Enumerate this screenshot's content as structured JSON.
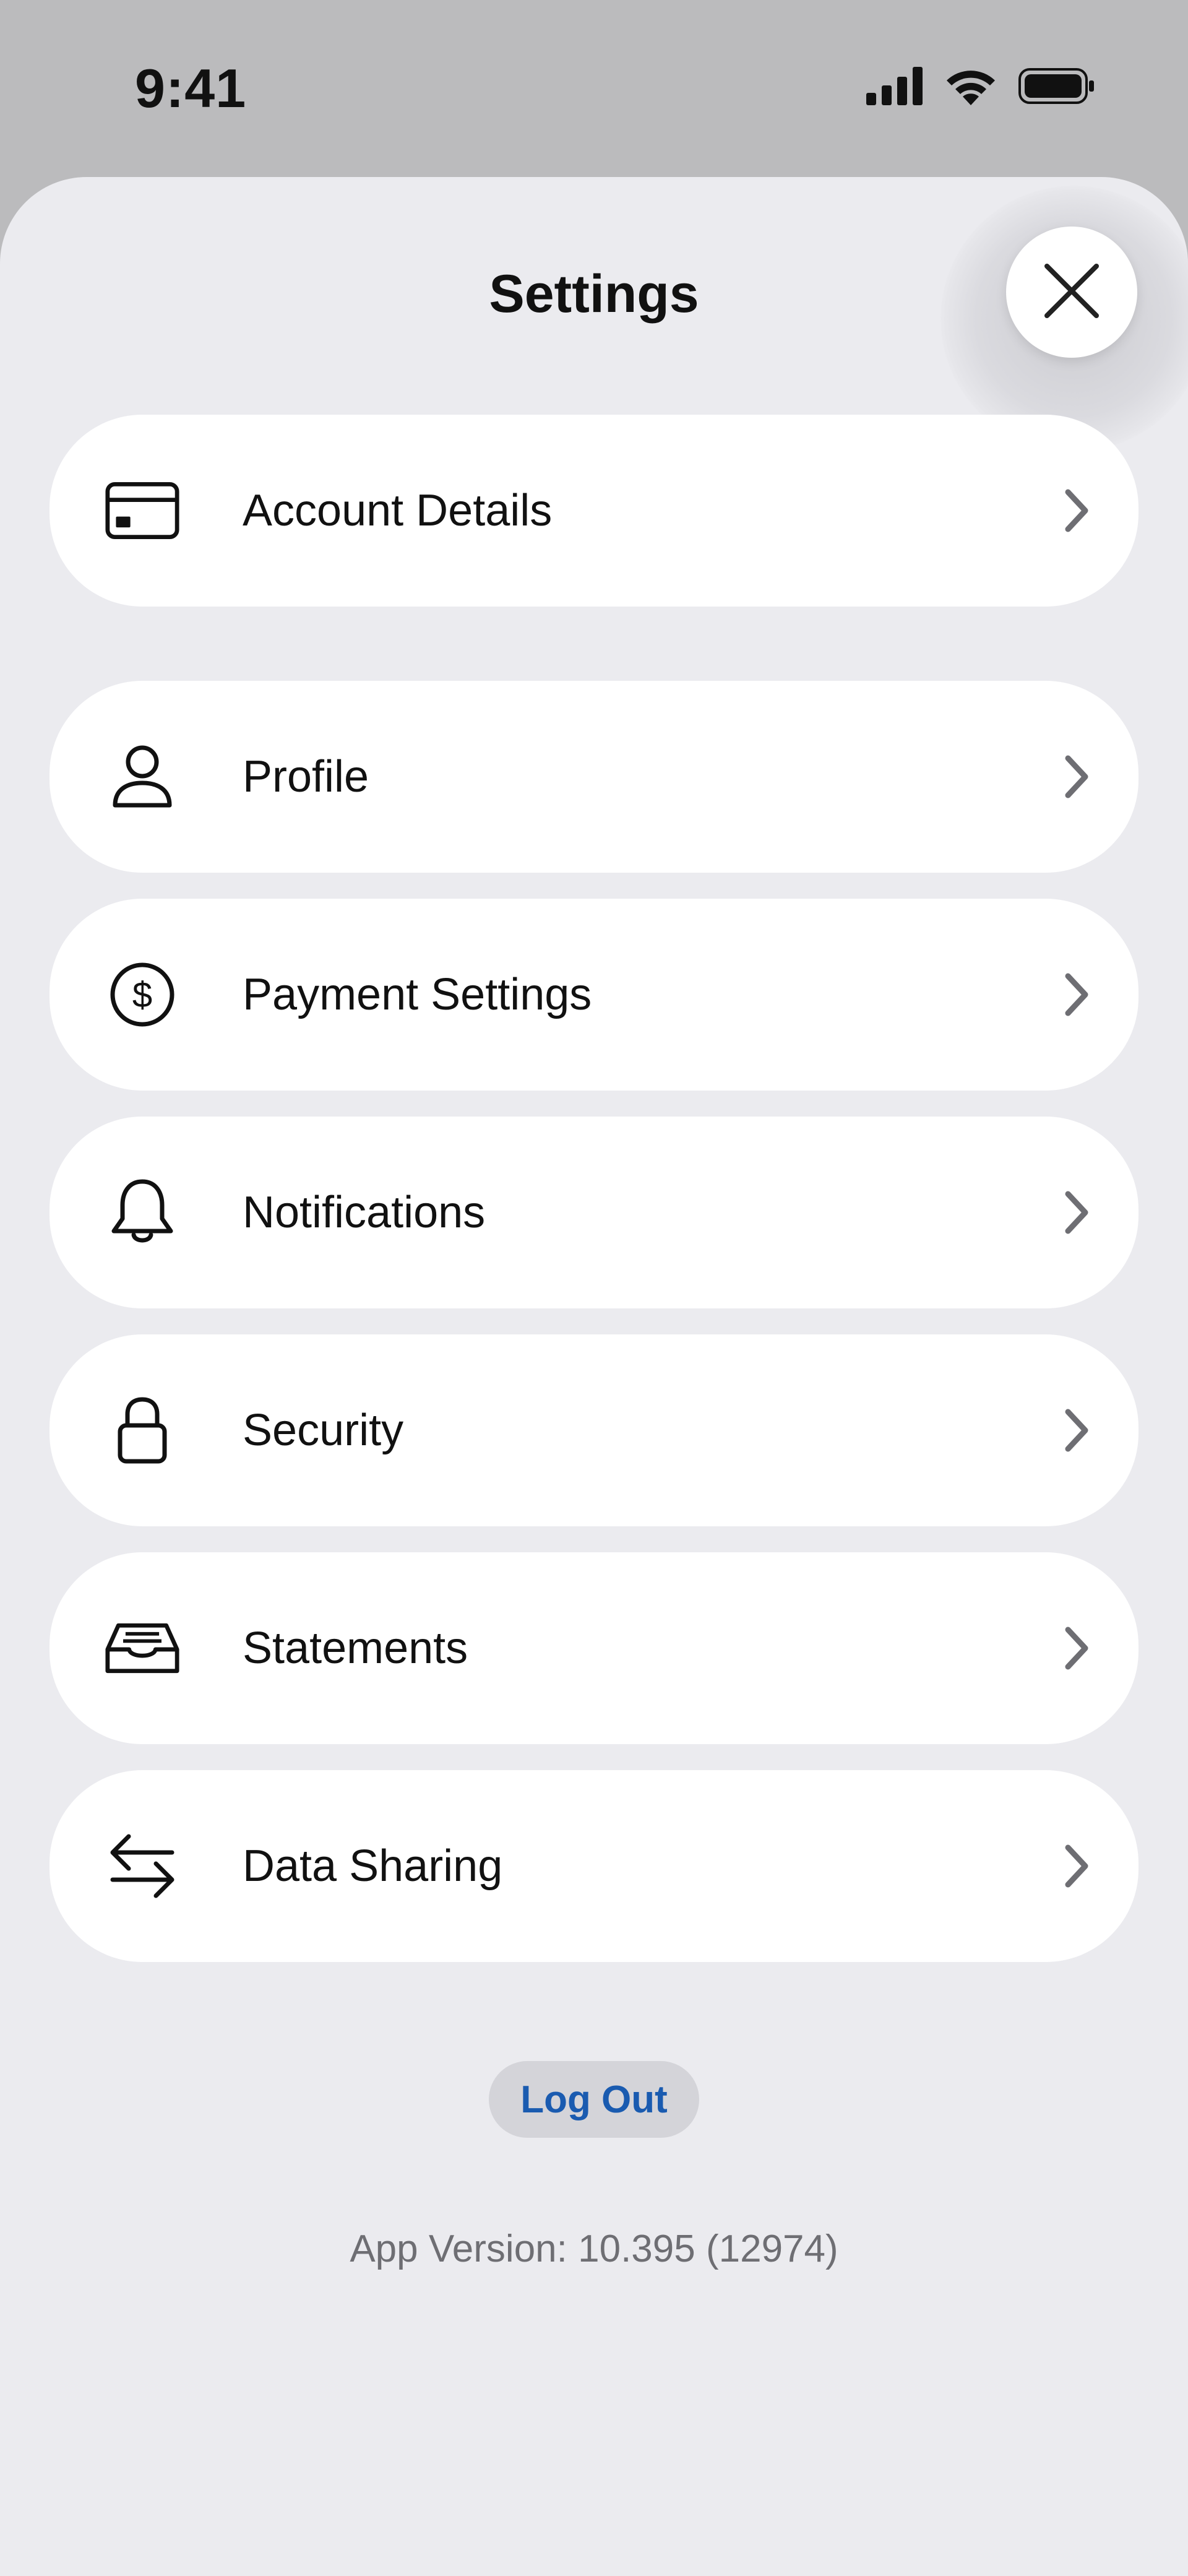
{
  "status_bar": {
    "time": "9:41",
    "icons": [
      "signal-icon",
      "wifi-icon",
      "battery-icon"
    ]
  },
  "header": {
    "title": "Settings",
    "close_icon": "close-icon"
  },
  "menu": {
    "items": [
      {
        "label": "Account Details",
        "icon": "card-icon"
      },
      {
        "label": "Profile",
        "icon": "person-icon"
      },
      {
        "label": "Payment Settings",
        "icon": "dollar-circle-icon"
      },
      {
        "label": "Notifications",
        "icon": "bell-icon"
      },
      {
        "label": "Security",
        "icon": "lock-icon"
      },
      {
        "label": "Statements",
        "icon": "inbox-tray-icon"
      },
      {
        "label": "Data Sharing",
        "icon": "arrows-swap-icon"
      }
    ]
  },
  "footer": {
    "logout_label": "Log Out",
    "app_version": "App Version: 10.395 (12974)"
  },
  "colors": {
    "sheet_background": "#EBEBEF",
    "status_background": "#BBBBBD",
    "row_background": "#FFFFFF",
    "logout_text": "#1A5BB0",
    "logout_background": "#D4D4D9",
    "version_text": "#6E6E73",
    "chevron": "#6E6E73"
  }
}
